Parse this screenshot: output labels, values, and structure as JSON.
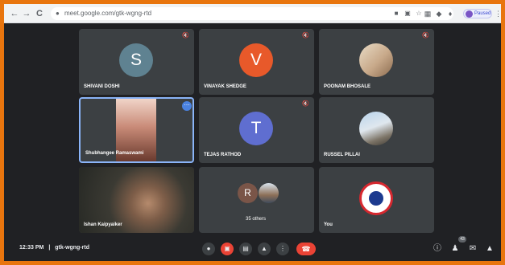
{
  "browser": {
    "back": "←",
    "forward": "→",
    "reload": "C",
    "url": "meet.google.com/gtk-wgng-rtd",
    "profile_label": "Paused",
    "icons": [
      "camera-icon",
      "cast-icon",
      "star-icon",
      "extension-icon",
      "shield-icon",
      "puzzle-icon"
    ]
  },
  "tiles": [
    {
      "name": "SHIVANI DOSHI",
      "initial": "S",
      "avatar_color": "#5f8291"
    },
    {
      "name": "VINAYAK SHEDGE",
      "initial": "V",
      "avatar_color": "#e8592a"
    },
    {
      "name": "POONAM BHOSALE"
    },
    {
      "name": "Shubhangee Ramaswami"
    },
    {
      "name": "TEJAS RATHOD",
      "initial": "T",
      "avatar_color": "#5f6ed0"
    },
    {
      "name": "RUSSEL PILLAI"
    },
    {
      "name": "Ishan Kaipyaiker"
    },
    {
      "initial": "R",
      "label": "35 others",
      "avatar_color": "#7a5548"
    },
    {
      "name": "You"
    }
  ],
  "bottom": {
    "time": "12:33 PM",
    "separator": "|",
    "meeting_code": "gtk-wgng-rtd",
    "participant_count": "43"
  }
}
